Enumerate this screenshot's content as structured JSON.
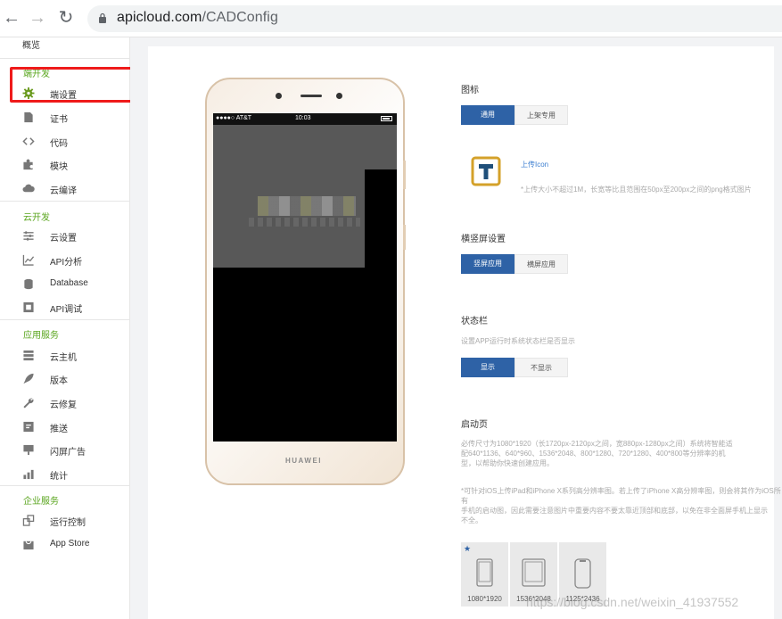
{
  "browser": {
    "url_domain": "apicloud.com",
    "url_path": "/CADConfig"
  },
  "sidebar": {
    "top_item": "概览",
    "groups": [
      {
        "title": "端开发",
        "items": [
          {
            "label": "端设置",
            "icon": "gear-icon"
          },
          {
            "label": "证书",
            "icon": "certificate-icon"
          },
          {
            "label": "代码",
            "icon": "code-icon"
          },
          {
            "label": "模块",
            "icon": "puzzle-icon"
          },
          {
            "label": "云编译",
            "icon": "cloud-icon"
          }
        ]
      },
      {
        "title": "云开发",
        "items": [
          {
            "label": "云设置",
            "icon": "sliders-icon"
          },
          {
            "label": "API分析",
            "icon": "chart-icon"
          },
          {
            "label": "Database",
            "icon": "database-icon"
          },
          {
            "label": "API调试",
            "icon": "debug-icon"
          }
        ]
      },
      {
        "title": "应用服务",
        "items": [
          {
            "label": "云主机",
            "icon": "server-icon"
          },
          {
            "label": "版本",
            "icon": "rocket-icon"
          },
          {
            "label": "云修复",
            "icon": "wrench-icon"
          },
          {
            "label": "推送",
            "icon": "push-icon"
          },
          {
            "label": "闪屏广告",
            "icon": "ad-icon"
          },
          {
            "label": "统计",
            "icon": "bar-icon"
          }
        ]
      },
      {
        "title": "企业服务",
        "items": [
          {
            "label": "运行控制",
            "icon": "control-icon"
          },
          {
            "label": "App Store",
            "icon": "store-icon"
          }
        ]
      }
    ]
  },
  "phone": {
    "carrier": "●●●●○ AT&T",
    "time": "10:03",
    "brand": "HUAWEI"
  },
  "settings": {
    "icon_section": {
      "title": "图标",
      "tab_general": "通用",
      "tab_release": "上架专用",
      "upload_label": "上传Icon",
      "hint": "*上传大小不超过1M，长宽等比且范围在50px至200px之间的png格式图片"
    },
    "orientation": {
      "title": "横竖屏设置",
      "portrait": "竖屏应用",
      "landscape": "横屏应用"
    },
    "statusbar": {
      "title": "状态栏",
      "hint": "设置APP运行时系统状态栏是否显示",
      "show": "显示",
      "hide": "不显示"
    },
    "launch": {
      "title": "启动页",
      "hint1_line1": "必传尺寸为1080*1920（长1720px-2120px之间，宽880px-1280px之间）系统将智能适",
      "hint1_line2": "配640*1136、640*960、1536*2048、800*1280、720*1280、400*800等分辨率的机",
      "hint1_line3": "型，以帮助你快速创建应用。",
      "hint2_line1": "*可针对iOS上传iPad和iPhone X系列高分辨率图。若上传了iPhone X高分辨率图，则会将其作为iOS所有",
      "hint2_line2": "手机的启动图，因此需要注意图片中重要内容不要太靠近顶部和底部，以免在非全面屏手机上显示",
      "hint2_line3": "不全。",
      "sizes": [
        "1080*1920",
        "1536*2048",
        "1125*2436"
      ]
    }
  },
  "watermark": "https://blog.csdn.net/weixin_41937552"
}
